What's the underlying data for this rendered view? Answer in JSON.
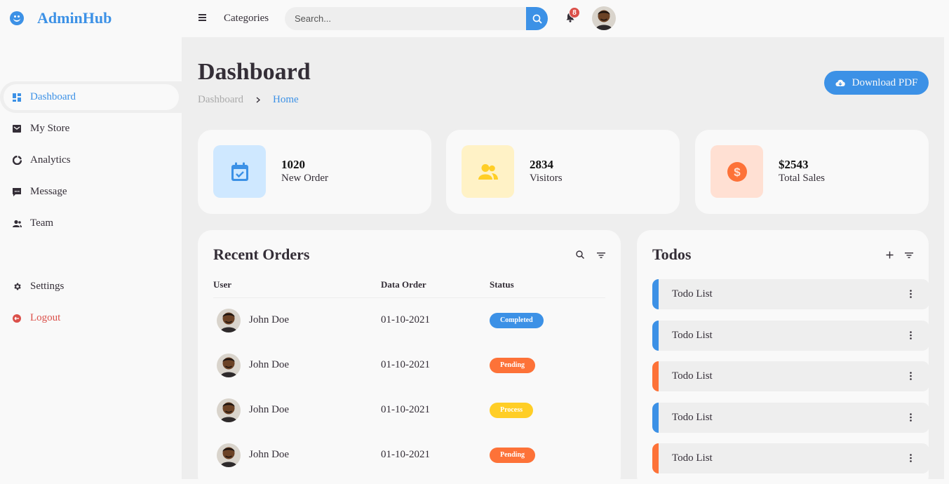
{
  "brand": {
    "name": "AdminHub"
  },
  "sidebar": {
    "items": [
      {
        "label": "Dashboard",
        "icon": "dashboard-icon"
      },
      {
        "label": "My Store",
        "icon": "store-icon"
      },
      {
        "label": "Analytics",
        "icon": "analytics-icon"
      },
      {
        "label": "Message",
        "icon": "message-icon"
      },
      {
        "label": "Team",
        "icon": "team-icon"
      }
    ],
    "bottom": [
      {
        "label": "Settings",
        "icon": "gear-icon"
      },
      {
        "label": "Logout",
        "icon": "logout-icon"
      }
    ]
  },
  "navbar": {
    "categories_label": "Categories",
    "search_placeholder": "Search...",
    "notification_count": "8"
  },
  "header": {
    "title": "Dashboard",
    "breadcrumb": [
      "Dashboard",
      "Home"
    ],
    "download_label": "Download PDF"
  },
  "stats": [
    {
      "value": "1020",
      "label": "New Order",
      "icon": "calendar-check-icon",
      "color": "#cfe8ff"
    },
    {
      "value": "2834",
      "label": "Visitors",
      "icon": "users-icon",
      "color": "#fff2c6"
    },
    {
      "value": "$2543",
      "label": "Total Sales",
      "icon": "dollar-icon",
      "color": "#ffe0d3"
    }
  ],
  "orders": {
    "title": "Recent Orders",
    "columns": [
      "User",
      "Data Order",
      "Status"
    ],
    "rows": [
      {
        "user": "John Doe",
        "date": "01-10-2021",
        "status": "Completed"
      },
      {
        "user": "John Doe",
        "date": "01-10-2021",
        "status": "Pending"
      },
      {
        "user": "John Doe",
        "date": "01-10-2021",
        "status": "Process"
      },
      {
        "user": "John Doe",
        "date": "01-10-2021",
        "status": "Pending"
      }
    ]
  },
  "todos": {
    "title": "Todos",
    "items": [
      {
        "label": "Todo List",
        "state": "completed"
      },
      {
        "label": "Todo List",
        "state": "completed"
      },
      {
        "label": "Todo List",
        "state": "not-completed"
      },
      {
        "label": "Todo List",
        "state": "completed"
      },
      {
        "label": "Todo List",
        "state": "not-completed"
      }
    ]
  },
  "colors": {
    "accent": "#3c91e6",
    "orange": "#fd7238",
    "yellow": "#ffce26",
    "red": "#db504a"
  }
}
